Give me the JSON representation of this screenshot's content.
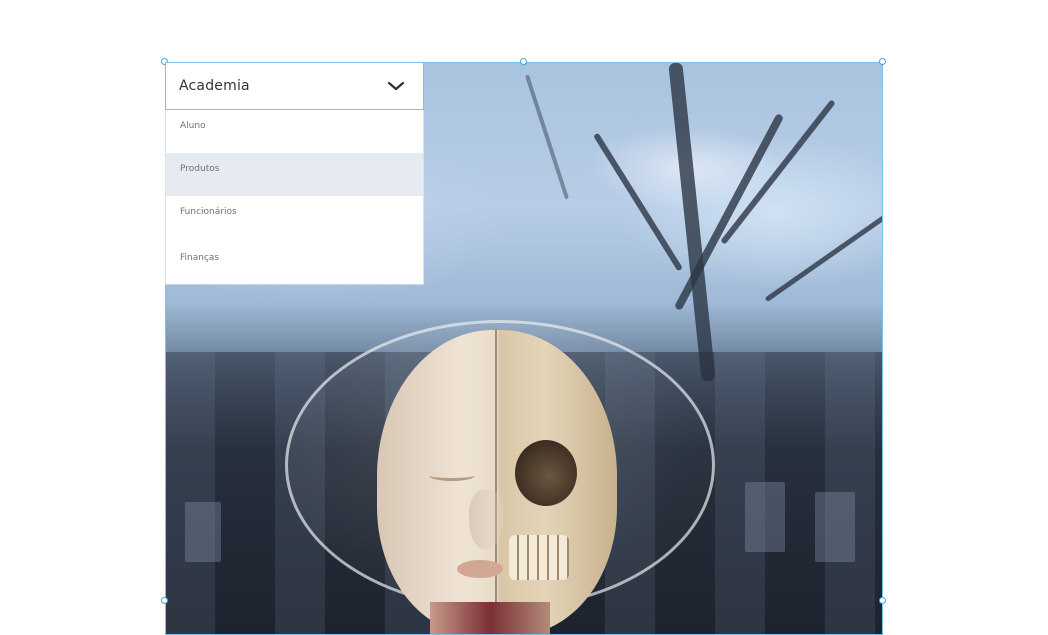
{
  "dropdown": {
    "selected": "Academia",
    "items": [
      {
        "label": "Aluno"
      },
      {
        "label": "Produtos"
      },
      {
        "label": "Funcionários"
      },
      {
        "label": "Finanças"
      }
    ],
    "hovered_index": 1
  },
  "colors": {
    "selection": "#7cc3ec",
    "handle_border": "#3fa7e0",
    "hover_bg": "#e6eaf1",
    "item_text": "#6b7180",
    "selected_text": "#2f3440"
  },
  "icons": {
    "dropdown_toggle": "chevron-down-icon"
  }
}
